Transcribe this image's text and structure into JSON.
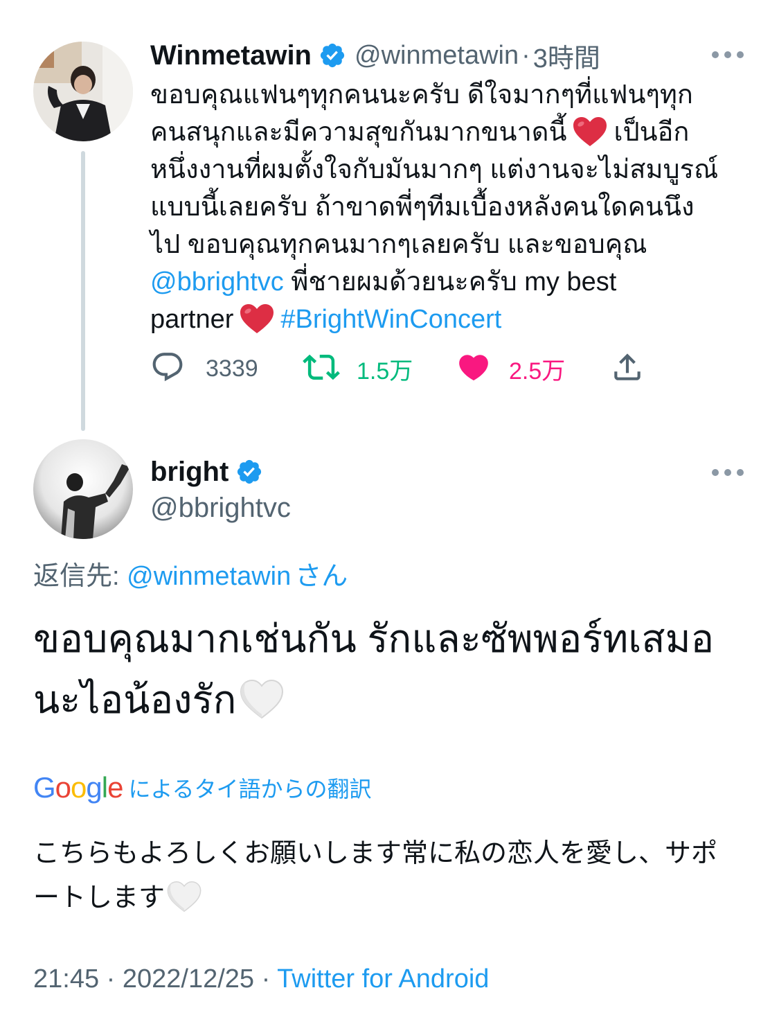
{
  "tweet": {
    "display_name": "Winmetawin",
    "handle": "@winmetawin",
    "separator": "·",
    "time": "3時間",
    "text_lines": [
      "ขอบคุณแฟนๆทุกคนนะครับ ดีใจมากๆที่แฟนๆทุก",
      "คนสนุกและมีความสุขกันมากขนาดนี้",
      "เป็นอีก",
      "หนึ่งงานที่ผมตั้งใจกับมันมากๆ แต่งานจะไม่สมบูรณ์",
      "แบบนี้เลยครับ ถ้าขาดพี่ๆทีมเบื้องหลังคนใดคนนึง",
      "ไป ขอบคุณทุกคนมากๆเลยครับ และขอบคุณ",
      "@bbrightvc",
      "พี่ชายผมด้วยนะครับ my best",
      "partner",
      "#BrightWinConcert"
    ],
    "replies": "3339",
    "retweets": "1.5万",
    "likes": "2.5万"
  },
  "reply": {
    "display_name": "bright",
    "handle": "@bbrightvc",
    "reply_to_label": "返信先:",
    "reply_to_handle": "@winmetawin",
    "reply_to_suffix": "さん",
    "text_lines": [
      "ขอบคุณมากเช่นกัน รักและซัพพอร์ทเสมอ",
      "นะไอน้องรัก"
    ],
    "translation_logo": "Google",
    "translation_label": "によるタイ語からの翻訳",
    "translated_lines": [
      "こちらもよろしくお願いします常に私の恋人を愛し、サポ",
      "ートします"
    ],
    "time": "21:45",
    "separator": "·",
    "date": "2022/12/25",
    "source": "Twitter for Android"
  },
  "colors": {
    "link": "#1d9bf0",
    "secondary_text": "#536471",
    "retweet": "#00ba7c",
    "like": "#f91880",
    "verified": "#1d9bf0"
  },
  "icons": {
    "verified": "verified-badge-icon",
    "more": "more-options-icon",
    "reply": "reply-icon",
    "retweet": "retweet-icon",
    "like": "heart-icon",
    "share": "share-icon",
    "red_heart": "red-heart-emoji",
    "white_heart": "white-heart-emoji"
  }
}
